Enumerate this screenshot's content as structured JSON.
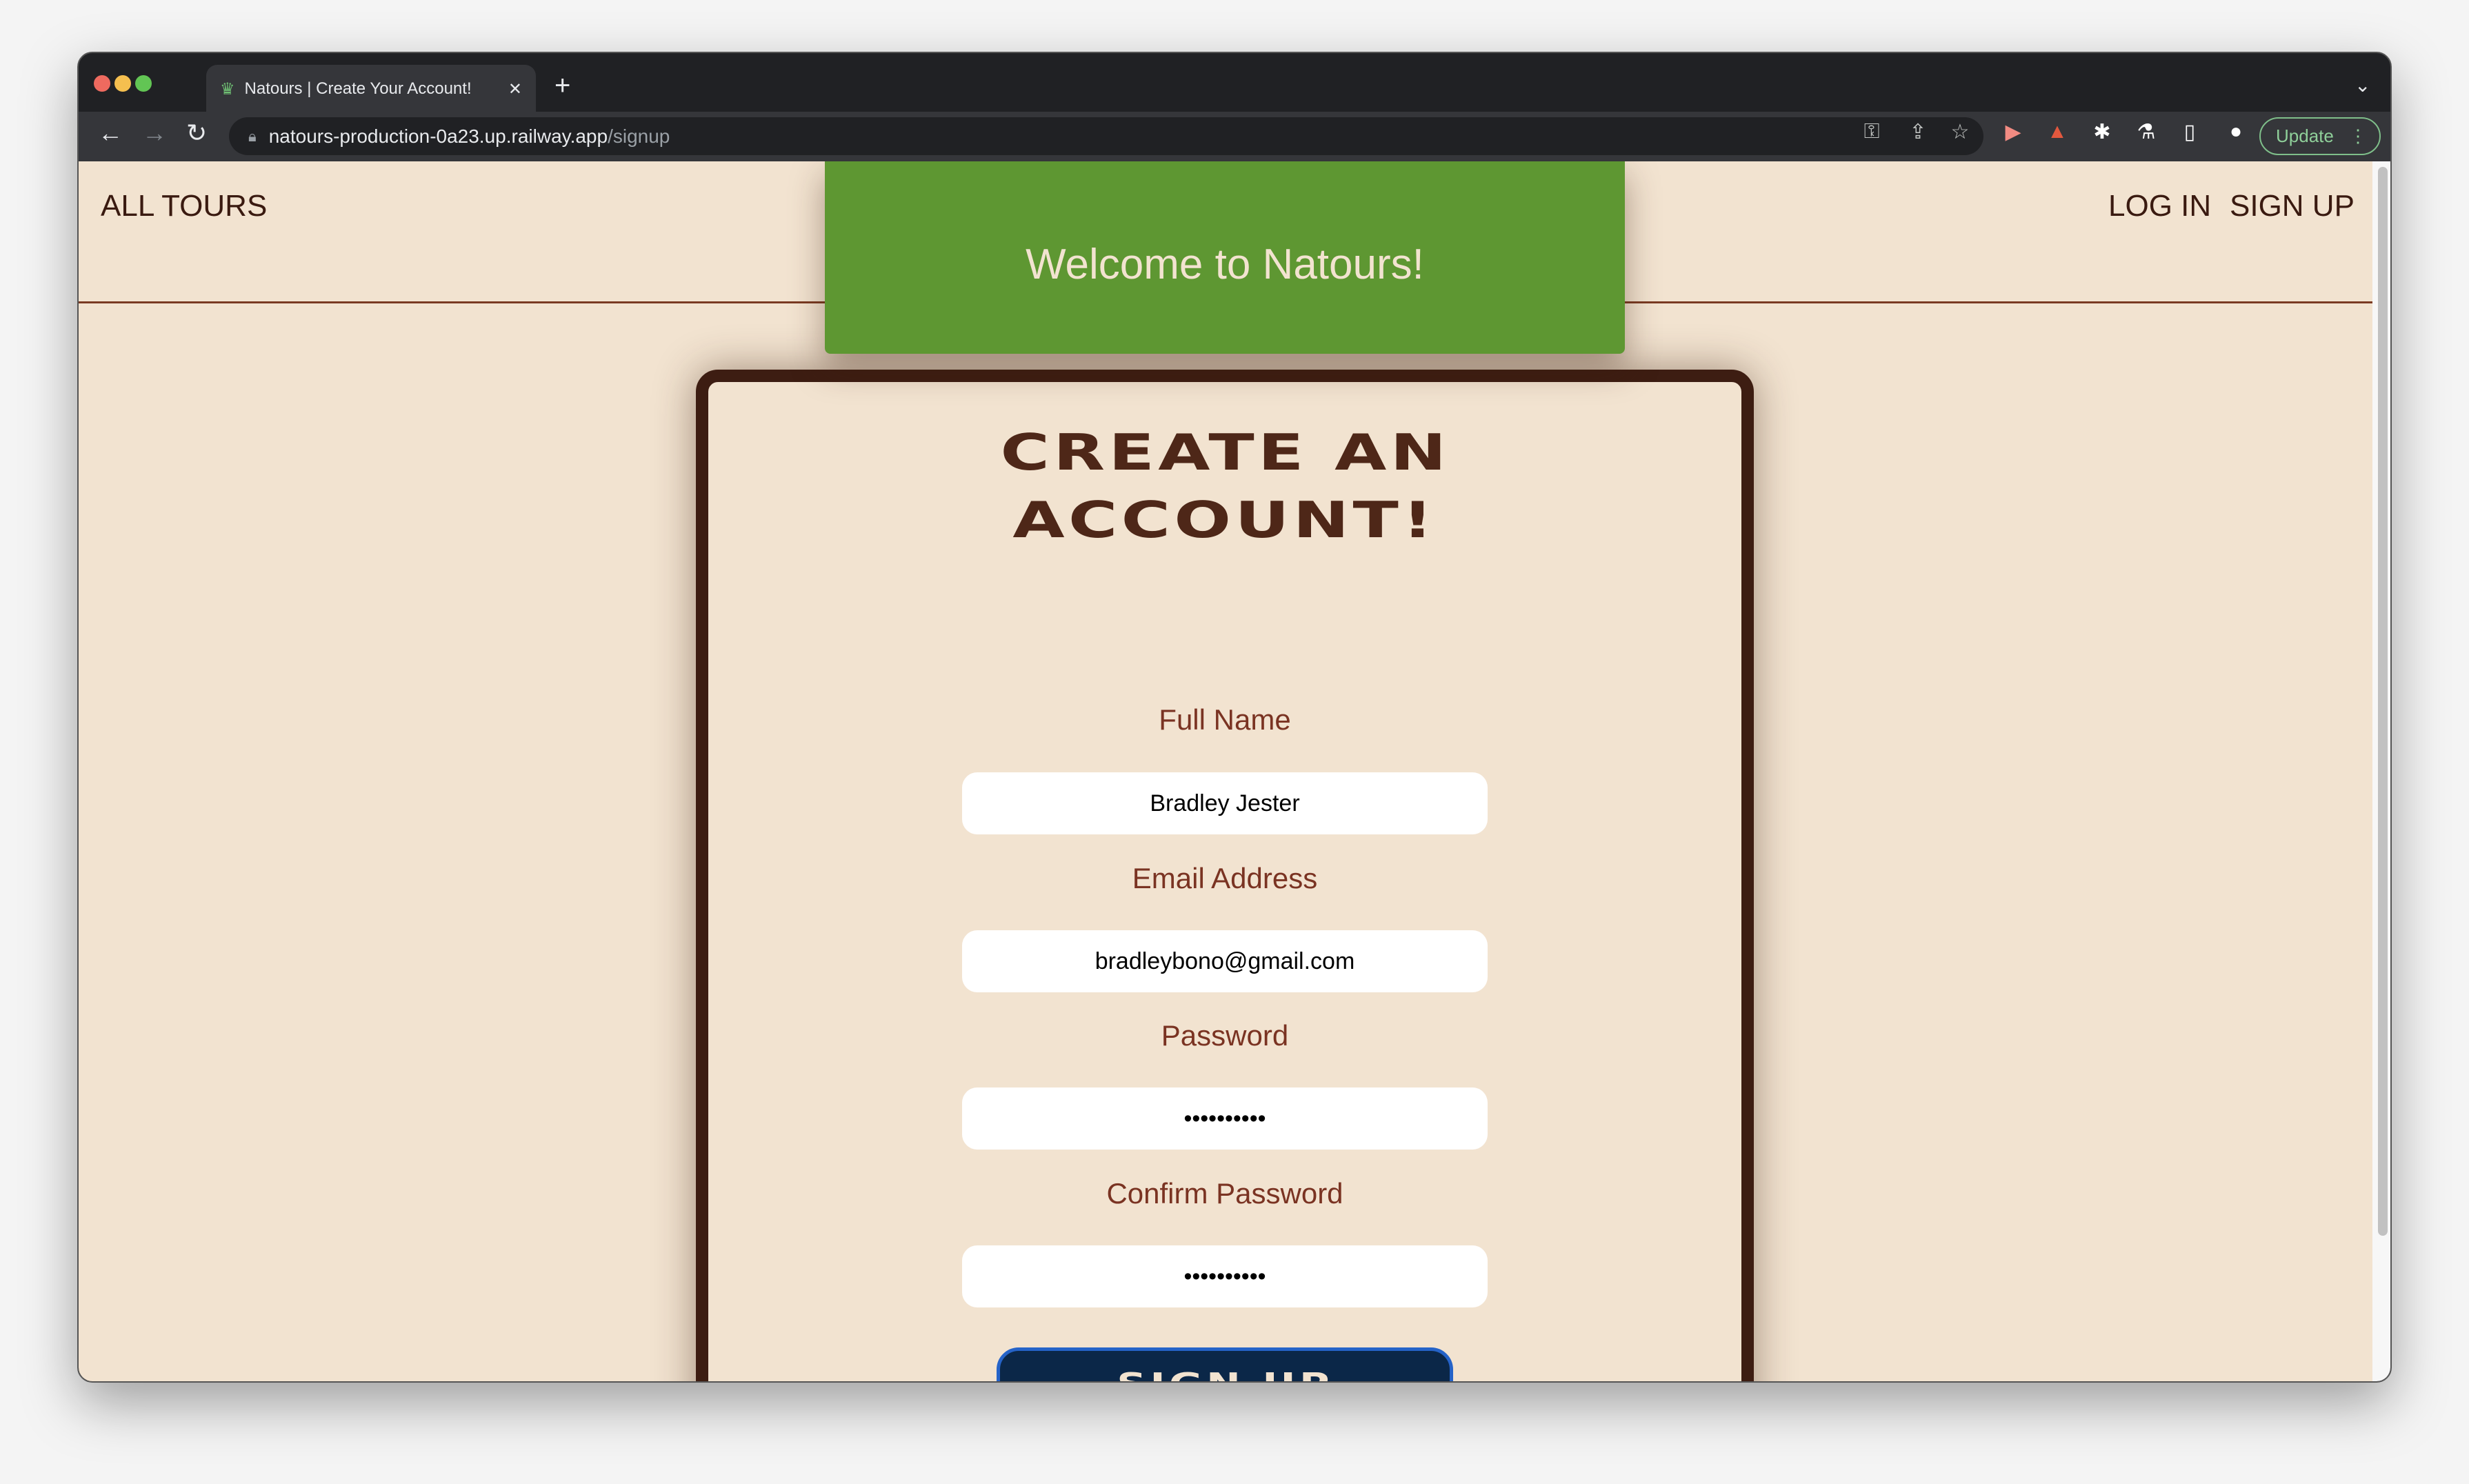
{
  "browser": {
    "tab_title": "Natours | Create Your Account!",
    "url_host": "natours-production-0a23.up.railway.app",
    "url_path": "/signup",
    "update_label": "Update",
    "colors": {
      "frame": "#202124",
      "toolbar": "#35363a",
      "update": "#8fcf99"
    }
  },
  "nav": {
    "all_tours": "ALL TOURS",
    "log_in": "LOG IN",
    "sign_up": "SIGN UP"
  },
  "banner": {
    "text": "Welcome to Natours!"
  },
  "form": {
    "heading_line1": "CREATE AN",
    "heading_line2": "ACCOUNT!",
    "fields": [
      {
        "label": "Full Name",
        "value": "Bradley Jester",
        "type": "text"
      },
      {
        "label": "Email Address",
        "value": "bradleybono@gmail.com",
        "type": "email"
      },
      {
        "label": "Password",
        "value": "••••••••••",
        "type": "password"
      },
      {
        "label": "Confirm Password",
        "value": "••••••••••",
        "type": "password"
      }
    ],
    "submit_label": "SIGN UP"
  },
  "colors": {
    "page_bg": "#f2e3d0",
    "banner": "#5e9732",
    "card_border": "#3d1d12",
    "label": "#7a3322",
    "button": "#0b2748",
    "button_border": "#2563c8"
  }
}
